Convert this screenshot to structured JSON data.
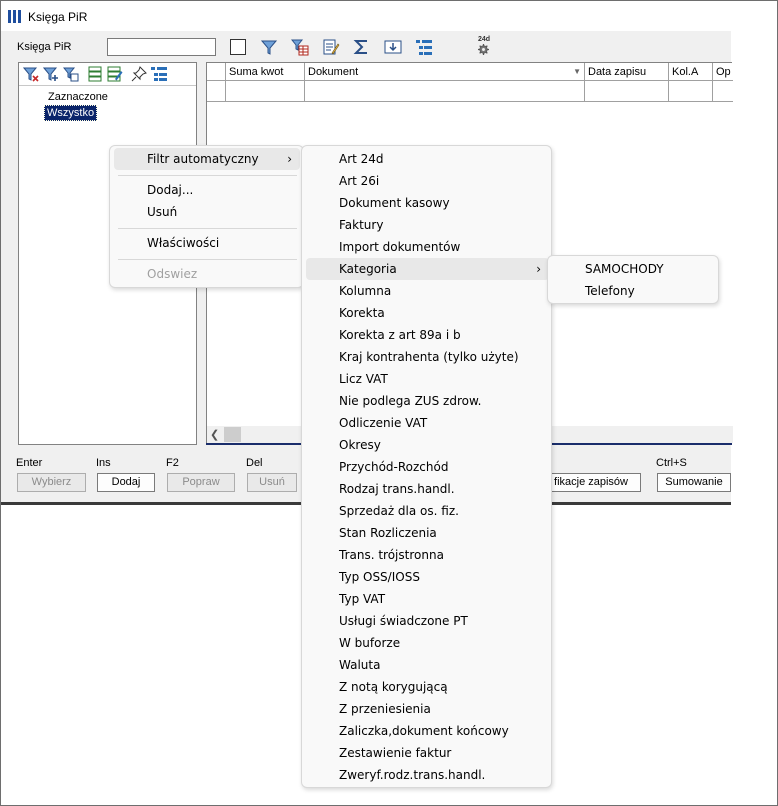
{
  "window": {
    "title": "Księga PiR"
  },
  "toolbar": {
    "label": "Księga PiR",
    "search_value": "",
    "icons": [
      "checkbox",
      "filter-icon",
      "filter-table-icon",
      "edit-doc-icon",
      "sum-icon",
      "download-icon",
      "list-icon",
      "gear-24d-icon"
    ],
    "gear_badge": "24d"
  },
  "tree": {
    "tool_icons": [
      "filter-clear-icon",
      "filter-add-icon",
      "filter-table-icon",
      "tree-list-icon",
      "tree-edit-icon",
      "pin-icon",
      "list-tree-icon"
    ],
    "items": [
      {
        "label": "Zaznaczone",
        "selected": false
      },
      {
        "label": "Wszystko",
        "selected": true
      }
    ]
  },
  "grid": {
    "columns": [
      "",
      "Suma kwot",
      "Dokument",
      "Data zapisu",
      "Kol.A",
      "Op"
    ]
  },
  "bottom": {
    "keys": [
      "Enter",
      "Ins",
      "F2",
      "Del",
      "Ctrl+S"
    ],
    "buttons": [
      "Wybierz",
      "Dodaj",
      "Popraw",
      "Usuń",
      "fikacje zapisów",
      "Sumowanie"
    ]
  },
  "context_menu": {
    "items": [
      {
        "label": "Filtr automatyczny",
        "submenu": true,
        "highlighted": true,
        "disabled": false
      },
      {
        "label": "Dodaj...",
        "submenu": false,
        "highlighted": false,
        "disabled": false
      },
      {
        "label": "Usuń",
        "submenu": false,
        "highlighted": false,
        "disabled": false
      },
      {
        "label": "Właściwości",
        "submenu": false,
        "highlighted": false,
        "disabled": false
      },
      {
        "label": "Odswiez",
        "submenu": false,
        "highlighted": false,
        "disabled": true
      }
    ]
  },
  "filter_submenu": {
    "items": [
      "Art 24d",
      "Art 26i",
      "Dokument kasowy",
      "Faktury",
      "Import dokumentów",
      "Kategoria",
      "Kolumna",
      "Korekta",
      "Korekta z art 89a i b",
      "Kraj kontrahenta (tylko użyte)",
      "Licz VAT",
      "Nie podlega ZUS zdrow.",
      "Odliczenie VAT",
      "Okresy",
      "Przychód-Rozchód",
      "Rodzaj trans.handl.",
      "Sprzedaż dla os. fiz.",
      "Stan Rozliczenia",
      "Trans. trójstronna",
      "Typ OSS/IOSS",
      "Typ VAT",
      "Usługi świadczone PT",
      "W buforze",
      "Waluta",
      "Z notą korygującą",
      "Z przeniesienia",
      "Zaliczka,dokument końcowy",
      "Zestawienie faktur",
      "Zweryf.rodz.trans.handl."
    ],
    "highlighted": "Kategoria"
  },
  "category_submenu": {
    "items": [
      "SAMOCHODY",
      "Telefony"
    ]
  },
  "colors": {
    "selection": "#0a246a",
    "accent_blue": "#1f4e9e",
    "menu_bg": "#f9f9f9"
  }
}
